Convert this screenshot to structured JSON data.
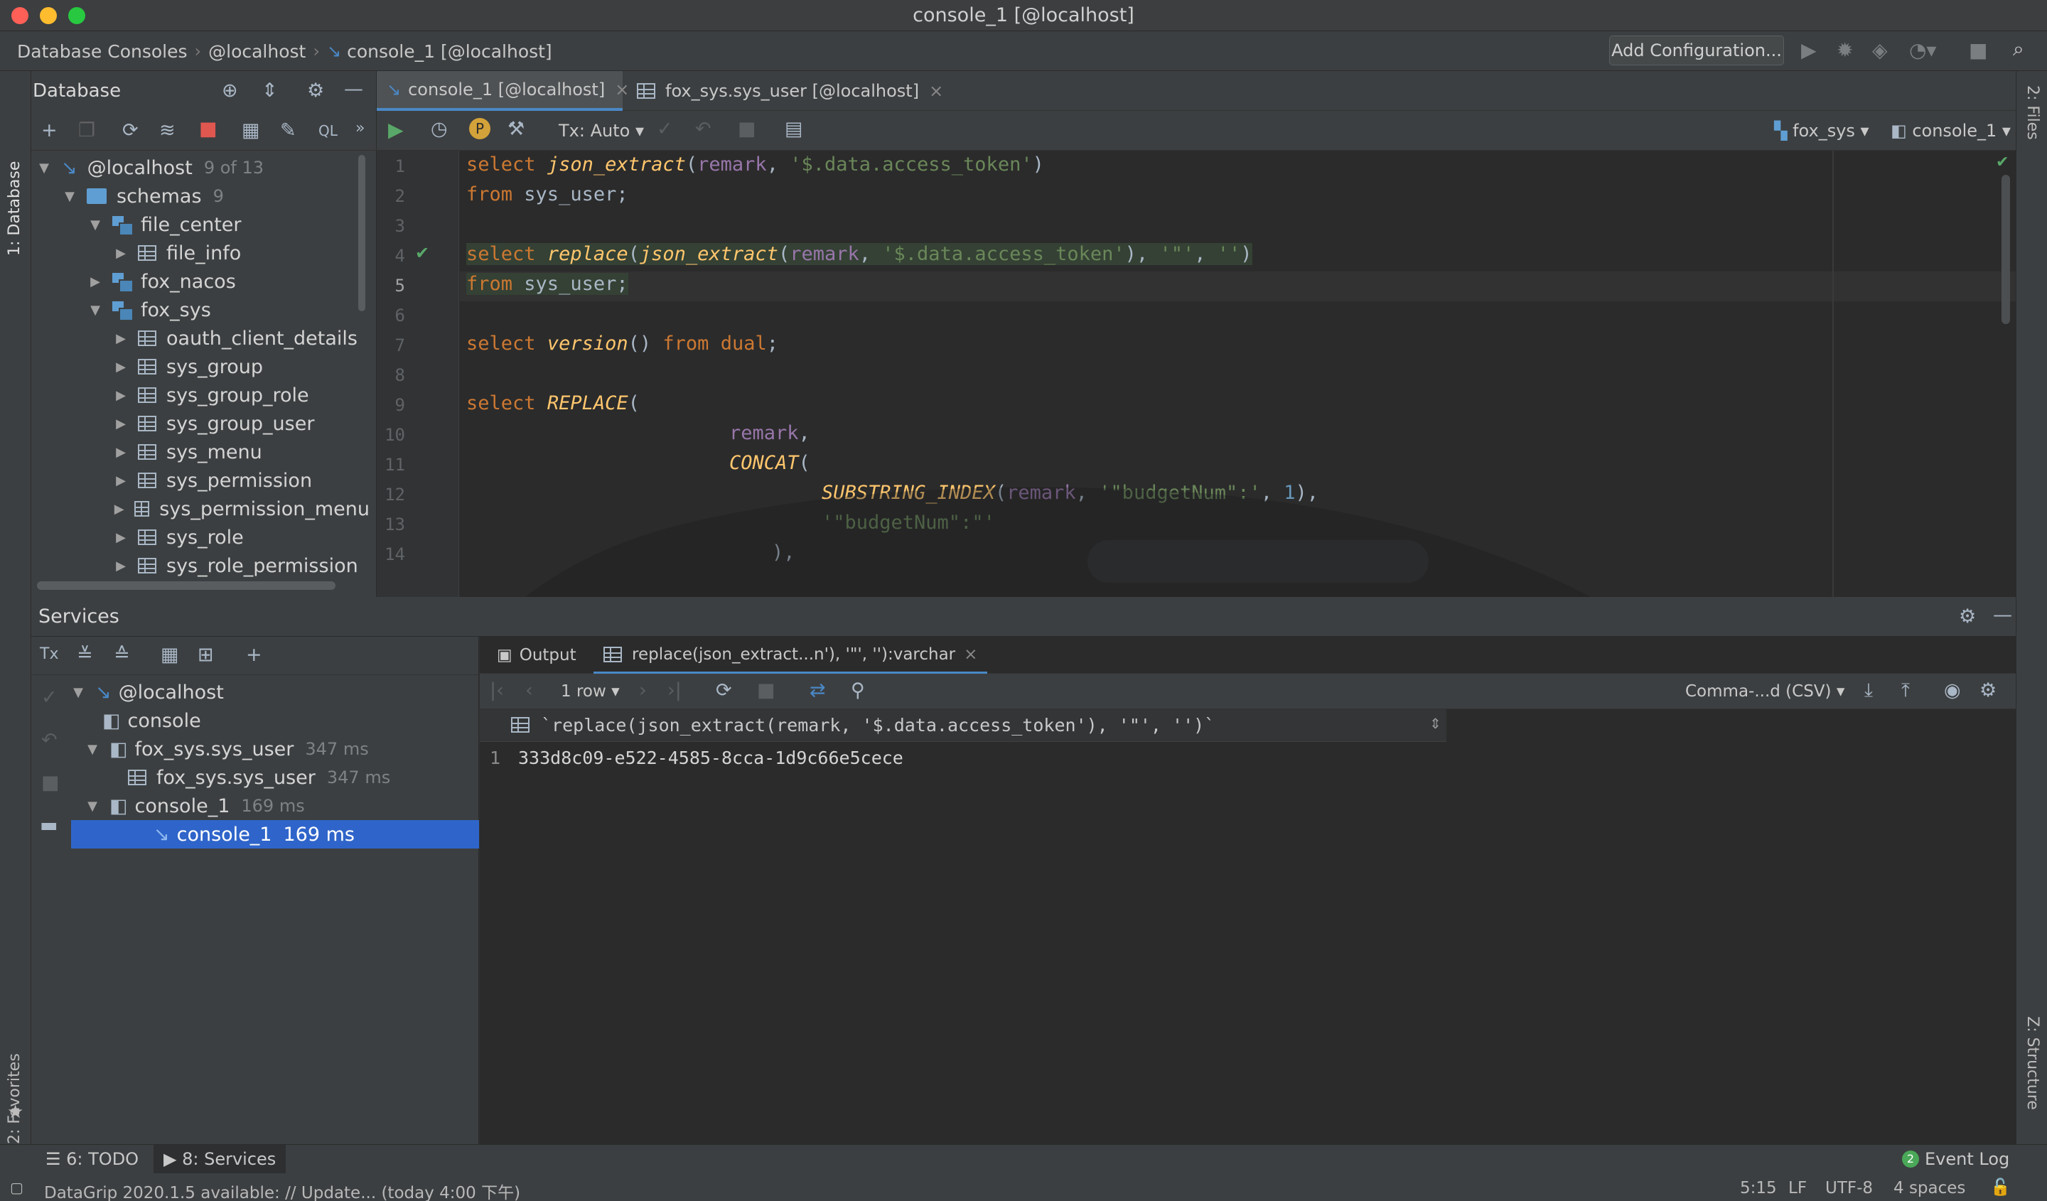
{
  "window": {
    "title": "console_1 [@localhost]"
  },
  "navbar": {
    "crumbs": [
      "Database Consoles",
      "@localhost",
      "console_1 [@localhost]"
    ],
    "add_config": "Add Configuration..."
  },
  "left_strip": {
    "database": "1: Database",
    "favorites": "2: Favorites"
  },
  "right_strip": {
    "files": "2: Files",
    "structure": "Z: Structure"
  },
  "db_panel": {
    "title": "Database",
    "tree": [
      {
        "label": "@localhost",
        "meta": "9 of 13"
      },
      {
        "label": "schemas",
        "meta": "9"
      },
      {
        "label": "file_center"
      },
      {
        "label": "file_info"
      },
      {
        "label": "fox_nacos"
      },
      {
        "label": "fox_sys"
      },
      {
        "label": "oauth_client_details"
      },
      {
        "label": "sys_group"
      },
      {
        "label": "sys_group_role"
      },
      {
        "label": "sys_group_user"
      },
      {
        "label": "sys_menu"
      },
      {
        "label": "sys_permission"
      },
      {
        "label": "sys_permission_menu"
      },
      {
        "label": "sys_role"
      },
      {
        "label": "sys_role_permission"
      }
    ]
  },
  "editor": {
    "tabs": [
      {
        "label": "console_1 [@localhost]"
      },
      {
        "label": "fox_sys.sys_user [@localhost]"
      }
    ],
    "tx_label": "Tx: Auto",
    "schema_selector": "fox_sys",
    "console_selector": "console_1",
    "line_numbers": [
      "1",
      "2",
      "3",
      "4",
      "5",
      "6",
      "7",
      "8",
      "9",
      "10",
      "11",
      "12",
      "13",
      "14"
    ],
    "tokens": {
      "select": "select",
      "from": "from",
      "json_extract": "json_extract",
      "replace_lc": "replace",
      "replace_uc": "REPLACE",
      "version": "version",
      "remark": "remark",
      "path": "'$.data.access_token'",
      "sys_user": "sys_user",
      "dual": "dual",
      "concat": "CONCAT",
      "substring_index": "SUBSTRING_INDEX",
      "budget_str": "'\"budgetNum\":'",
      "budget_str2": "'\"budgetNum\":\"'",
      "quote_str": "'\"'",
      "empty_str": "''",
      "one": "1"
    }
  },
  "services": {
    "title": "Services",
    "tree": [
      {
        "label": "@localhost"
      },
      {
        "label": "console"
      },
      {
        "label": "fox_sys.sys_user",
        "meta": "347 ms"
      },
      {
        "label": "fox_sys.sys_user",
        "meta": "347 ms"
      },
      {
        "label": "console_1",
        "meta": "169 ms"
      },
      {
        "label": "console_1",
        "meta": "169 ms"
      }
    ],
    "output_tab": "Output",
    "result_tab": "replace(json_extract...n'), '\"', ''):varchar",
    "rows_label": "1 row",
    "export_format": "Comma-...d (CSV)",
    "column_header": "`replace(json_extract(remark, '$.data.access_token'), '\"', '')`",
    "row_number": "1",
    "cell_value": "333d8c09-e522-4585-8cca-1d9c66e5cece"
  },
  "bottom_tabs": {
    "todo": "6: TODO",
    "services": "8: Services",
    "event_log": "Event Log",
    "event_count": "2"
  },
  "status": {
    "message": "DataGrip 2020.1.5 available: // Update... (today 4:00 下午)",
    "position": "5:15",
    "line_sep": "LF",
    "encoding": "UTF-8",
    "indent": "4 spaces"
  },
  "colors": {
    "accent": "#2f65ca",
    "keyword": "#cc7832",
    "function": "#ffc66d",
    "string": "#6a8759",
    "column": "#9876aa",
    "number": "#6897bb"
  }
}
